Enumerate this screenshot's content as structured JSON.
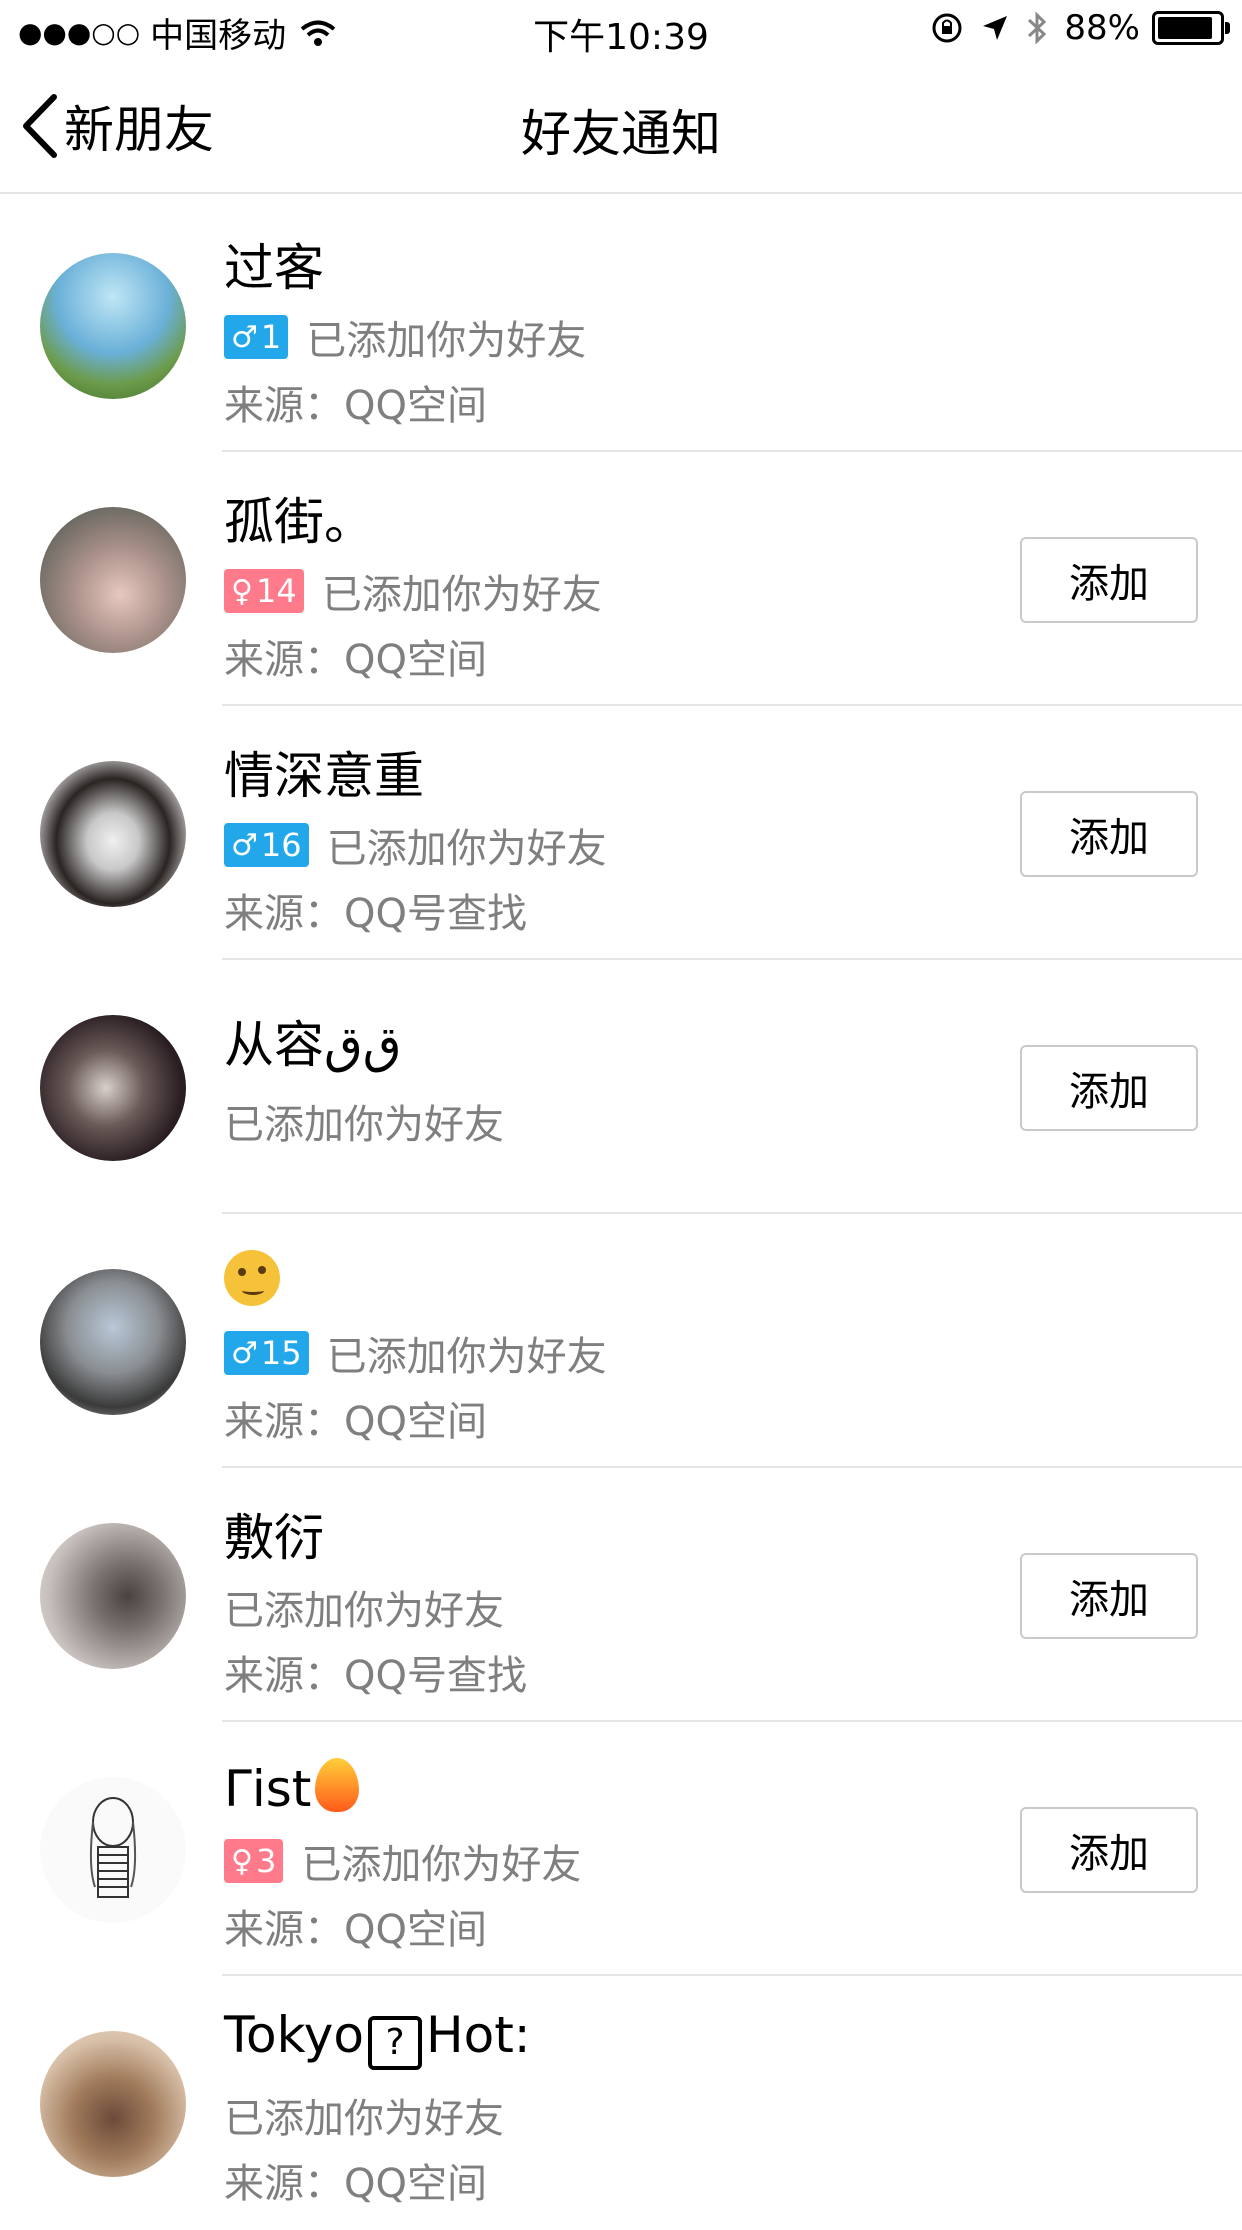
{
  "status_bar": {
    "signal": "●●●○○",
    "carrier": "中国移动",
    "time": "下午10:39",
    "battery": "88%"
  },
  "nav": {
    "back_label": "新朋友",
    "title": "好友通知"
  },
  "items": [
    {
      "name": "过客",
      "badge": "1",
      "badge_gender": "male",
      "status": "已添加你为好友",
      "source": "来源：QQ空间",
      "add_button": ""
    },
    {
      "name": "孤街。",
      "badge": "14",
      "badge_gender": "female",
      "status": "已添加你为好友",
      "source": "来源：QQ空间",
      "add_button": "添加"
    },
    {
      "name": "情深意重",
      "badge": "16",
      "badge_gender": "male",
      "status": "已添加你为好友",
      "source": "来源：QQ号查找",
      "add_button": "添加"
    },
    {
      "name": "从容ﻕﻕ",
      "badge": "",
      "badge_gender": "",
      "status": "已添加你为好友",
      "source": "",
      "add_button": "添加"
    },
    {
      "name": "",
      "badge": "15",
      "badge_gender": "male",
      "status": "已添加你为好友",
      "source": "来源：QQ空间",
      "add_button": ""
    },
    {
      "name": "敷衍",
      "badge": "",
      "badge_gender": "",
      "status": "已添加你为好友",
      "source": "来源：QQ号查找",
      "add_button": "添加"
    },
    {
      "name": "Γist",
      "badge": "3",
      "badge_gender": "female",
      "status": "已添加你为好友",
      "source": "来源：QQ空间",
      "add_button": "添加"
    },
    {
      "name_a": "Tokyo",
      "name_q": "?",
      "name_b": "Hot:",
      "status": "已添加你为好友",
      "source": "来源：QQ空间"
    }
  ],
  "colors": {
    "male_badge": "#22a8ea",
    "female_badge": "#ff7a8a",
    "secondary_text": "#7f7f7f",
    "divider": "#e6e6e6"
  }
}
